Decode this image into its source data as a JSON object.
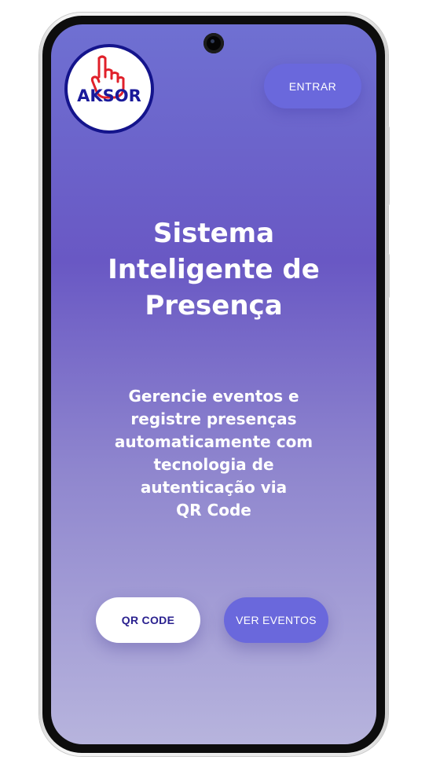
{
  "header": {
    "logo_text": "AKSOR",
    "login_label": "ENTRAR"
  },
  "hero": {
    "title_lines": [
      "Sistema",
      "Inteligente de",
      "Presença"
    ],
    "subtitle_lines": [
      "Gerencie eventos e",
      "registre presenças",
      "automaticamente com",
      "tecnologia de",
      "autenticação via",
      "QR Code"
    ]
  },
  "actions": {
    "qr_label": "QR CODE",
    "events_label": "VER EVENTOS"
  },
  "colors": {
    "primary": "#6a68dc",
    "logo_blue": "#1a1a9a",
    "logo_red": "#e0202a",
    "gradient_top": "#6f70d2",
    "gradient_bottom": "#b7b4dd"
  },
  "icons": {
    "logo": "hand-pointing-up-icon",
    "camera": "front-camera-icon"
  }
}
